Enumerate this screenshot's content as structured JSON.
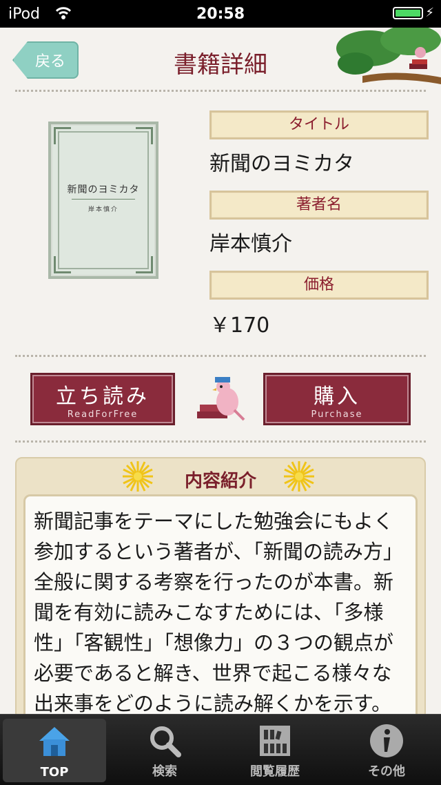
{
  "status_bar": {
    "carrier": "iPod",
    "time": "20:58"
  },
  "nav": {
    "back_label": "戻る",
    "title": "書籍詳細"
  },
  "book": {
    "cover_title": "新聞のヨミカタ",
    "cover_author": "岸本慎介",
    "title_label": "タイトル",
    "title": "新聞のヨミカタ",
    "author_label": "著者名",
    "author": "岸本慎介",
    "price_label": "価格",
    "price": "￥170"
  },
  "actions": {
    "read_jp": "立ち読み",
    "read_en": "ReadForFree",
    "buy_jp": "購入",
    "buy_en": "Purchase"
  },
  "description": {
    "heading": "内容紹介",
    "text": "新聞記事をテーマにした勉強会にもよく参加するという著者が、「新聞の読み方」全般に関する考察を行ったのが本書。新聞を有効に読みこなすためには、「多様性」「客観性」「想像力」の３つの観点が必要であると解き、世界で起こる様々な出来事をどのように読み解くかを示す。"
  },
  "tabs": [
    {
      "label": "TOP",
      "icon": "home-icon",
      "active": true
    },
    {
      "label": "検索",
      "icon": "search-icon",
      "active": false
    },
    {
      "label": "閲覧履歴",
      "icon": "history-icon",
      "active": false
    },
    {
      "label": "その他",
      "icon": "info-icon",
      "active": false
    }
  ],
  "colors": {
    "accent": "#7a1f2b",
    "button": "#8a2b3c",
    "back_button": "#8fd0c3"
  }
}
